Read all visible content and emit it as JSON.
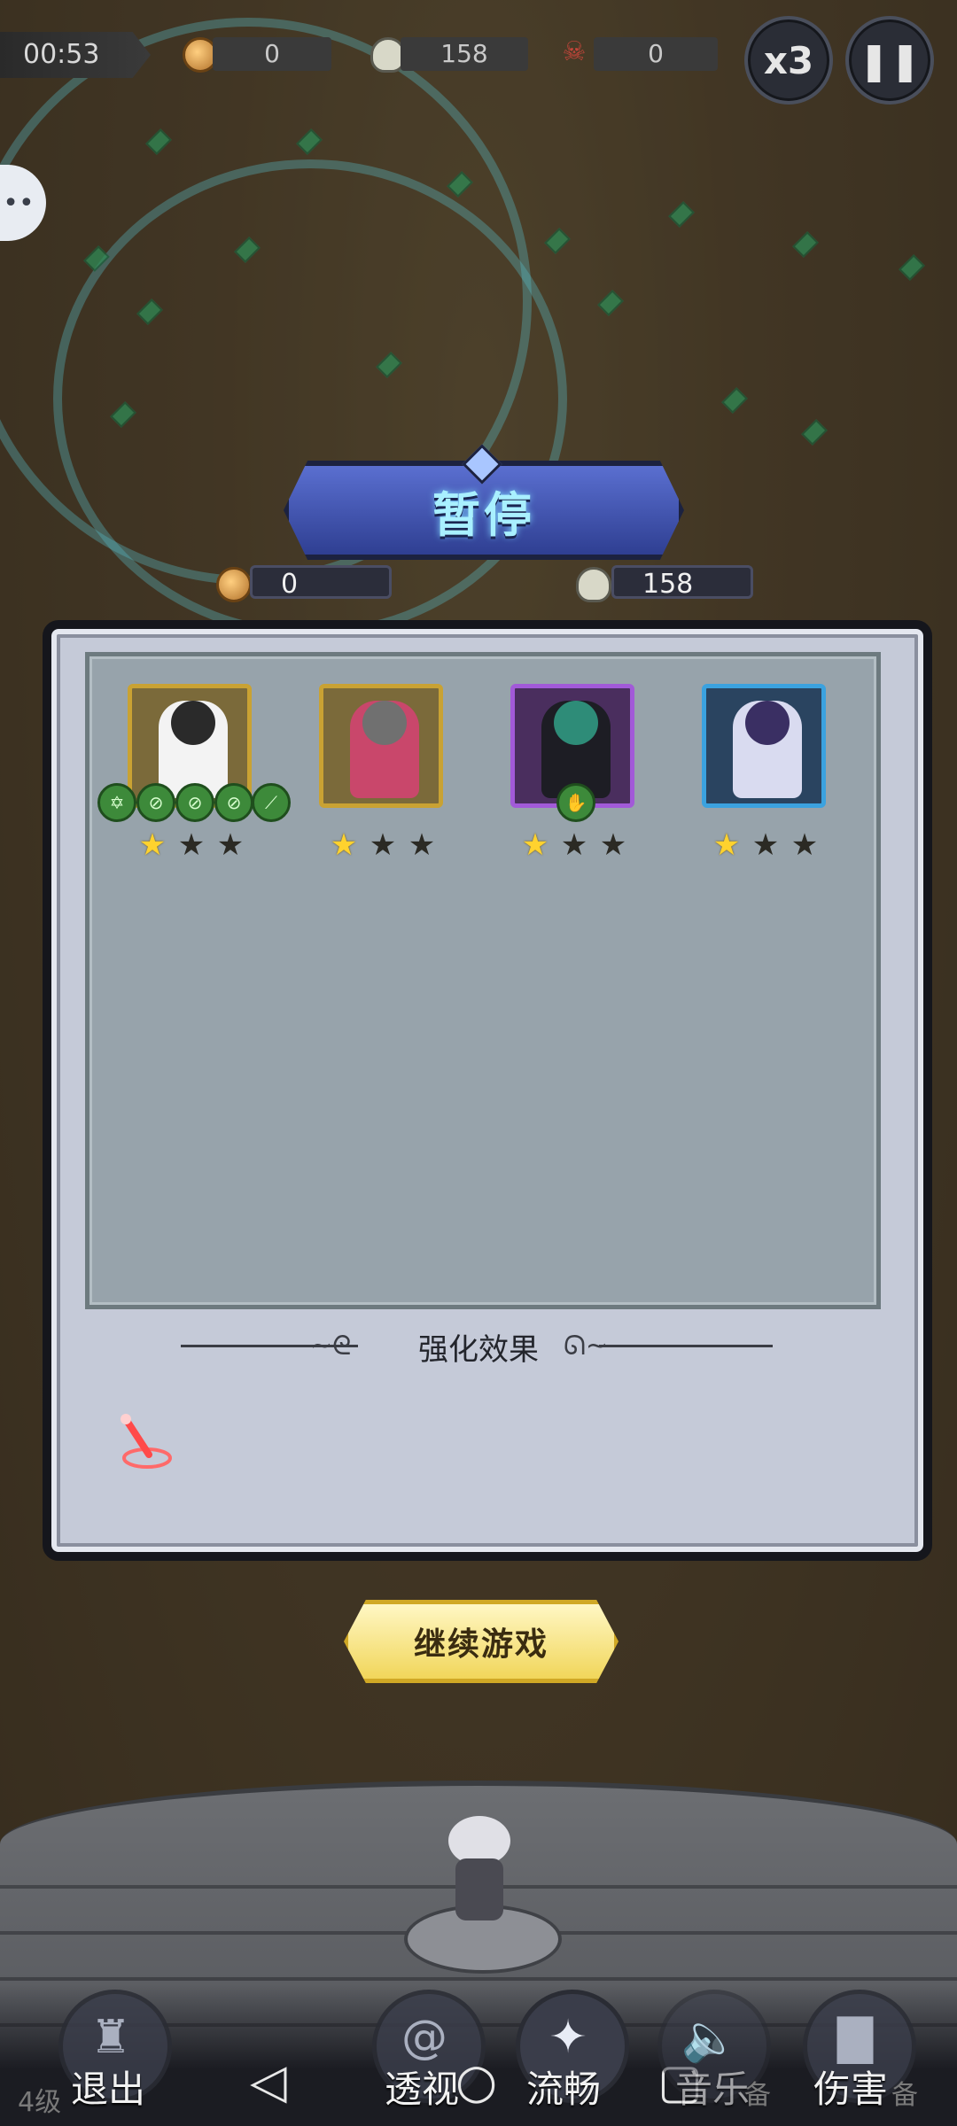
{
  "hud": {
    "timer": "00:53",
    "coins": "0",
    "kills": "158",
    "boss_kills": "0",
    "speed_label": "x3"
  },
  "pause_dialog": {
    "title": "暂停",
    "coins": "0",
    "kills": "158",
    "enhance_title": "强化效果",
    "continue_label": "继续游戏",
    "heroes": [
      {
        "stars": 1,
        "max_stars": 3,
        "frame": "gold"
      },
      {
        "stars": 1,
        "max_stars": 3,
        "frame": "gold"
      },
      {
        "stars": 1,
        "max_stars": 3,
        "frame": "purple"
      },
      {
        "stars": 1,
        "max_stars": 3,
        "frame": "blue"
      }
    ]
  },
  "bottom_bar": {
    "level_hint": "4级",
    "exit_label": "退出",
    "see_through_label": "透视",
    "smooth_label": "流畅",
    "music_label": "音乐",
    "damage_label": "伤害",
    "equip_hint": "备"
  },
  "colors": {
    "accent_gold": "#f1d65a",
    "banner_blue": "#3f52b0",
    "star_on": "#ffd22e"
  }
}
